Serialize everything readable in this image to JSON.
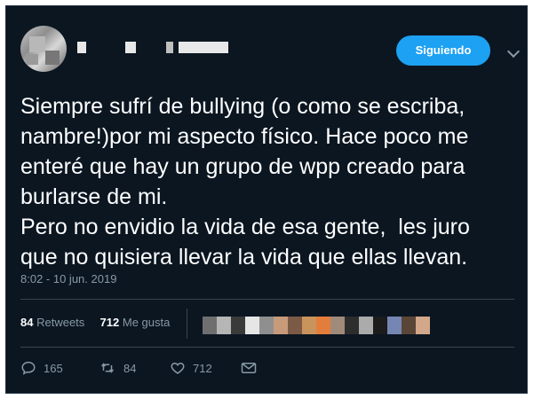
{
  "header": {
    "follow_button_label": "Siguiendo"
  },
  "tweet": {
    "text": "Siempre sufrí de bullying (o como se escriba,\nnambre!)por mi aspecto físico. Hace poco me\nenteré que hay un grupo de wpp creado para\nburlarse de mi.\nPero no envidio la vida de esa gente,  les juro\nque no quisiera llevar la vida que ellas llevan.",
    "timestamp": "8:02 - 10 jun. 2019"
  },
  "stats": {
    "retweets_count": "84",
    "retweets_label": "Retweets",
    "likes_count": "712",
    "likes_label": "Me gusta"
  },
  "actions": {
    "reply_count": "165",
    "retweet_count": "84",
    "like_count": "712"
  },
  "icons": {
    "reply": "reply-icon",
    "retweet": "retweet-icon",
    "like": "heart-icon",
    "dm": "envelope-icon",
    "more": "chevron-down-icon"
  },
  "colors": {
    "background": "#0b1621",
    "accent": "#1da1f2",
    "muted_text": "#8899a6",
    "divider": "#38444d"
  }
}
